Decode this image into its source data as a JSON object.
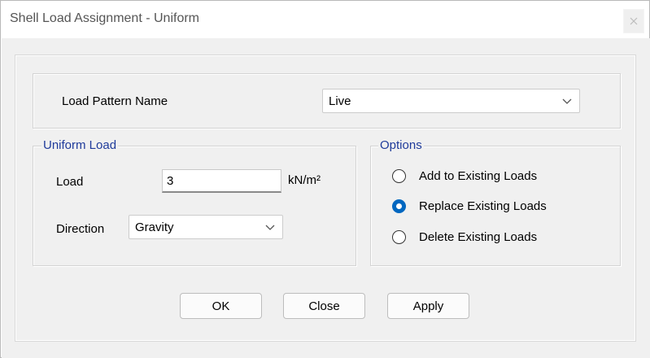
{
  "window": {
    "title": "Shell Load Assignment - Uniform"
  },
  "load_pattern": {
    "label": "Load Pattern Name",
    "selected": "Live"
  },
  "uniform_load": {
    "group_title": "Uniform Load",
    "load_label": "Load",
    "load_value": "3",
    "unit": "kN/m²",
    "direction_label": "Direction",
    "direction_selected": "Gravity"
  },
  "options": {
    "group_title": "Options",
    "items": [
      {
        "label": "Add to Existing Loads",
        "checked": false
      },
      {
        "label": "Replace Existing Loads",
        "checked": true
      },
      {
        "label": "Delete Existing Loads",
        "checked": false
      }
    ]
  },
  "buttons": {
    "ok": "OK",
    "close": "Close",
    "apply": "Apply"
  },
  "colors": {
    "accent": "#0067c0",
    "group_title": "#1f3b9b",
    "dialog_bg": "#f0f0f0"
  },
  "icons": {
    "close": "close-icon",
    "dropdown": "chevron-down-icon"
  }
}
